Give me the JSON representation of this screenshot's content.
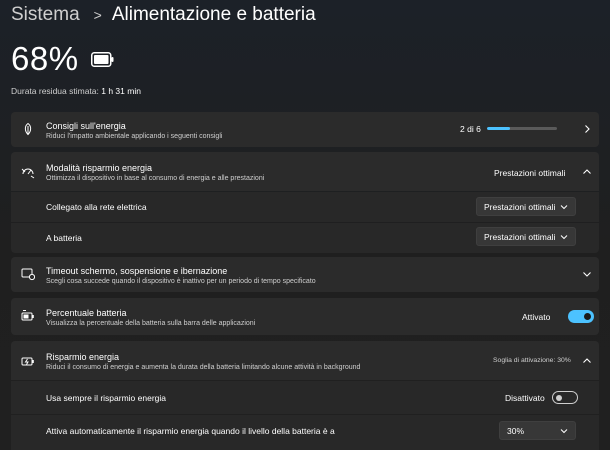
{
  "breadcrumb": {
    "parent": "Sistema",
    "separator": ">",
    "current": "Alimentazione e batteria"
  },
  "battery": {
    "percent": "68%",
    "remaining_label": "Durata residua stimata:",
    "remaining_value": "1 h 31 min",
    "level": 0.68
  },
  "energy_tips": {
    "title": "Consigli sull'energia",
    "desc": "Riduci l'impatto ambientale applicando i seguenti consigli",
    "progress_text": "2 di 6",
    "progress": 0.33,
    "icon": "leaf-icon"
  },
  "power_mode": {
    "title": "Modalità risparmio energia",
    "desc": "Ottimizza il dispositivo in base al consumo di energia e alle prestazioni",
    "value": "Prestazioni ottimali",
    "icon": "power-mode-icon",
    "plugged_label": "Collegato alla rete elettrica",
    "plugged_value": "Prestazioni ottimali",
    "battery_label": "A batteria",
    "battery_value": "Prestazioni ottimali"
  },
  "timeout": {
    "title": "Timeout schermo, sospensione e ibernazione",
    "desc": "Scegli cosa succede quando il dispositivo è inattivo per un periodo di tempo specificato",
    "icon": "screen-timeout-icon"
  },
  "battery_percentage": {
    "title": "Percentuale batteria",
    "desc": "Visualizza la percentuale della batteria sulla barra delle applicazioni",
    "state": "Attivato",
    "icon": "battery-percent-icon"
  },
  "energy_saver": {
    "title": "Risparmio energia",
    "desc": "Riduci il consumo di energia e aumenta la durata della batteria limitando alcune attività in background",
    "threshold_text": "Soglia di attivazione: 30%",
    "icon": "energy-saver-icon",
    "always_label": "Usa sempre il risparmio energia",
    "always_state": "Disattivato",
    "auto_label": "Attiva automaticamente il risparmio energia quando il livello della batteria è a",
    "auto_value": "30%"
  },
  "colors": {
    "accent": "#4cc2ff",
    "card": "#2b2b2b",
    "subcard": "#282828"
  }
}
